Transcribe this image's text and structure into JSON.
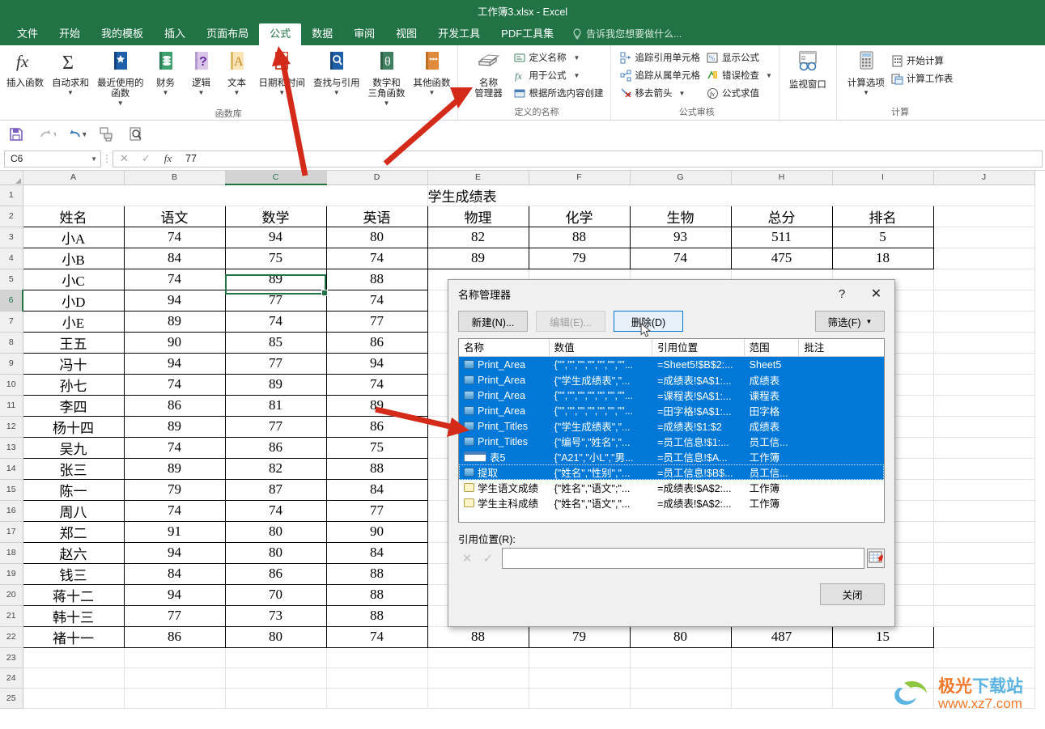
{
  "window": {
    "title": "工作簿3.xlsx - Excel"
  },
  "tabs": [
    {
      "label": "文件",
      "active": false
    },
    {
      "label": "开始",
      "active": false
    },
    {
      "label": "我的模板",
      "active": false
    },
    {
      "label": "插入",
      "active": false
    },
    {
      "label": "页面布局",
      "active": false
    },
    {
      "label": "公式",
      "active": true
    },
    {
      "label": "数据",
      "active": false
    },
    {
      "label": "审阅",
      "active": false
    },
    {
      "label": "视图",
      "active": false
    },
    {
      "label": "开发工具",
      "active": false
    },
    {
      "label": "PDF工具集",
      "active": false
    }
  ],
  "tellme": {
    "placeholder": "告诉我您想要做什么...",
    "icon": "lightbulb-icon"
  },
  "ribbon": {
    "groups": [
      {
        "label": "函数库",
        "buttons": [
          {
            "label": "插入函数",
            "icon": "fx-icon",
            "caret": false
          },
          {
            "label": "自动求和",
            "icon": "autosum-icon",
            "caret": true
          },
          {
            "label": "最近使用的\n函数",
            "icon": "recent-functions-icon",
            "caret": true
          },
          {
            "label": "财务",
            "icon": "financial-icon",
            "caret": true
          },
          {
            "label": "逻辑",
            "icon": "logical-icon",
            "caret": true
          },
          {
            "label": "文本",
            "icon": "text-icon",
            "caret": true
          },
          {
            "label": "日期和时间",
            "icon": "date-time-icon",
            "caret": true
          },
          {
            "label": "查找与引用",
            "icon": "lookup-reference-icon",
            "caret": true
          },
          {
            "label": "数学和\n三角函数",
            "icon": "math-trig-icon",
            "caret": true
          },
          {
            "label": "其他函数",
            "icon": "more-functions-icon",
            "caret": true
          }
        ]
      },
      {
        "label": "定义的名称",
        "big": {
          "label": "名称\n管理器",
          "icon": "name-manager-icon"
        },
        "items": [
          {
            "label": "定义名称",
            "icon": "define-name-icon",
            "caret": true
          },
          {
            "label": "用于公式",
            "icon": "use-in-formula-icon",
            "caret": true
          },
          {
            "label": "根据所选内容创建",
            "icon": "create-from-selection-icon",
            "caret": false
          }
        ]
      },
      {
        "label": "公式审核",
        "col1": [
          {
            "label": "追踪引用单元格",
            "icon": "trace-precedents-icon",
            "caret": false
          },
          {
            "label": "追踪从属单元格",
            "icon": "trace-dependents-icon",
            "caret": false
          },
          {
            "label": "移去箭头",
            "icon": "remove-arrows-icon",
            "caret": true
          }
        ],
        "col2": [
          {
            "label": "显示公式",
            "icon": "show-formulas-icon",
            "caret": false
          },
          {
            "label": "错误检查",
            "icon": "error-checking-icon",
            "caret": true
          },
          {
            "label": "公式求值",
            "icon": "evaluate-formula-icon",
            "caret": false
          }
        ]
      },
      {
        "label": "",
        "watch": {
          "label": "监视窗口",
          "icon": "watch-window-icon"
        }
      },
      {
        "label": "计算",
        "big": {
          "label": "计算选项",
          "icon": "calc-options-icon"
        },
        "items": [
          {
            "label": "开始计算",
            "icon": "calculate-now-icon",
            "caret": false
          },
          {
            "label": "计算工作表",
            "icon": "calculate-sheet-icon",
            "caret": false
          }
        ]
      }
    ]
  },
  "qat": [
    "save-icon",
    "redo-icon",
    "undo-icon",
    "quick-print-icon",
    "print-preview-icon"
  ],
  "formula_bar": {
    "name_box": "C6",
    "cancel_icon": "cancel-icon",
    "enter_icon": "enter-icon",
    "fx_icon": "fx-icon",
    "value": "77"
  },
  "sheet": {
    "columns": [
      "A",
      "B",
      "C",
      "D",
      "E",
      "F",
      "G",
      "H",
      "I",
      "J"
    ],
    "selected_column": "C",
    "selected_row": 6,
    "selected_cell": "C6",
    "title_row": {
      "row": 1,
      "text": "学生成绩表"
    },
    "headers": [
      "姓名",
      "语文",
      "数学",
      "英语",
      "物理",
      "化学",
      "生物",
      "总分",
      "排名"
    ],
    "rows": [
      {
        "n": 3,
        "cells": [
          "小A",
          "74",
          "94",
          "80",
          "82",
          "88",
          "93",
          "511",
          "5"
        ]
      },
      {
        "n": 4,
        "cells": [
          "小B",
          "84",
          "75",
          "74",
          "89",
          "79",
          "74",
          "475",
          "18"
        ]
      },
      {
        "n": 5,
        "cells": [
          "小C",
          "74",
          "89",
          "88",
          "",
          "",
          "",
          "",
          ""
        ]
      },
      {
        "n": 6,
        "cells": [
          "小D",
          "94",
          "77",
          "74",
          "",
          "",
          "",
          "",
          ""
        ]
      },
      {
        "n": 7,
        "cells": [
          "小E",
          "89",
          "74",
          "77",
          "",
          "",
          "",
          "",
          ""
        ]
      },
      {
        "n": 8,
        "cells": [
          "王五",
          "90",
          "85",
          "86",
          "",
          "",
          "",
          "",
          ""
        ]
      },
      {
        "n": 9,
        "cells": [
          "冯十",
          "94",
          "77",
          "94",
          "",
          "",
          "",
          "",
          ""
        ]
      },
      {
        "n": 10,
        "cells": [
          "孙七",
          "74",
          "89",
          "74",
          "",
          "",
          "",
          "",
          ""
        ]
      },
      {
        "n": 11,
        "cells": [
          "李四",
          "86",
          "81",
          "89",
          "",
          "",
          "",
          "",
          ""
        ]
      },
      {
        "n": 12,
        "cells": [
          "杨十四",
          "89",
          "77",
          "86",
          "",
          "",
          "",
          "",
          ""
        ]
      },
      {
        "n": 13,
        "cells": [
          "吴九",
          "74",
          "86",
          "75",
          "",
          "",
          "",
          "",
          ""
        ]
      },
      {
        "n": 14,
        "cells": [
          "张三",
          "89",
          "82",
          "88",
          "",
          "",
          "",
          "",
          ""
        ]
      },
      {
        "n": 15,
        "cells": [
          "陈一",
          "79",
          "87",
          "84",
          "",
          "",
          "",
          "",
          ""
        ]
      },
      {
        "n": 16,
        "cells": [
          "周八",
          "74",
          "74",
          "77",
          "",
          "",
          "",
          "",
          ""
        ]
      },
      {
        "n": 17,
        "cells": [
          "郑二",
          "91",
          "80",
          "90",
          "",
          "",
          "",
          "",
          ""
        ]
      },
      {
        "n": 18,
        "cells": [
          "赵六",
          "94",
          "80",
          "84",
          "",
          "",
          "",
          "",
          ""
        ]
      },
      {
        "n": 19,
        "cells": [
          "钱三",
          "84",
          "86",
          "88",
          "",
          "",
          "",
          "",
          ""
        ]
      },
      {
        "n": 20,
        "cells": [
          "蒋十二",
          "94",
          "70",
          "88",
          "",
          "",
          "",
          "",
          ""
        ]
      },
      {
        "n": 21,
        "cells": [
          "韩十三",
          "77",
          "73",
          "88",
          "",
          "",
          "",
          "",
          ""
        ]
      },
      {
        "n": 22,
        "cells": [
          "褚十一",
          "86",
          "80",
          "74",
          "88",
          "79",
          "80",
          "487",
          "15"
        ]
      }
    ],
    "empty_rows": [
      23,
      24,
      25
    ]
  },
  "dialog": {
    "title": "名称管理器",
    "help_icon": "help-icon",
    "close_icon": "close-icon",
    "buttons": {
      "new": "新建(N)...",
      "edit": "编辑(E)...",
      "delete": "删除(D)",
      "filter": "筛选(F)",
      "close": "关闭"
    },
    "columns": [
      "名称",
      "数值",
      "引用位置",
      "范围",
      "批注"
    ],
    "rows": [
      {
        "icon": "name-range-icon",
        "name": "Print_Area",
        "value": "{\"\",\"\",\"\",\"\",\"\",\"\",\"\"...",
        "refers_to": "=Sheet5!$B$2:...",
        "scope": "Sheet5",
        "comment": "",
        "selected": true
      },
      {
        "icon": "name-range-icon",
        "name": "Print_Area",
        "value": "{\"学生成绩表\",\"...",
        "refers_to": "=成绩表!$A$1:...",
        "scope": "成绩表",
        "comment": "",
        "selected": true
      },
      {
        "icon": "name-range-icon",
        "name": "Print_Area",
        "value": "{\"\",\"\",\"\",\"\",\"\",\"\",\"\"...",
        "refers_to": "=课程表!$A$1:...",
        "scope": "课程表",
        "comment": "",
        "selected": true
      },
      {
        "icon": "name-range-icon",
        "name": "Print_Area",
        "value": "{\"\",\"\",\"\",\"\",\"\",\"\",\"\"...",
        "refers_to": "=田字格!$A$1:...",
        "scope": "田字格",
        "comment": "",
        "selected": true
      },
      {
        "icon": "name-range-icon",
        "name": "Print_Titles",
        "value": "{\"学生成绩表\",\"...",
        "refers_to": "=成绩表!$1:$2",
        "scope": "成绩表",
        "comment": "",
        "selected": true
      },
      {
        "icon": "name-range-icon",
        "name": "Print_Titles",
        "value": "{\"编号\",\"姓名\",\"...",
        "refers_to": "=员工信息!$1:...",
        "scope": "员工信...",
        "comment": "",
        "selected": true
      },
      {
        "icon": "table-icon",
        "name": "表5",
        "value": "{\"A21\",\"小L\",\"男...",
        "refers_to": "=员工信息!$A...",
        "scope": "工作簿",
        "comment": "",
        "selected": true
      },
      {
        "icon": "name-range-icon",
        "name": "提取",
        "value": "{\"姓名\",\"性别\",\"...",
        "refers_to": "=员工信息!$B$...",
        "scope": "员工信...",
        "comment": "",
        "selected": true,
        "cursor": true
      },
      {
        "icon": "named-formula-icon",
        "name": "学生语文成绩",
        "value": "{\"姓名\",\"语文\";\"...",
        "refers_to": "=成绩表!$A$2:...",
        "scope": "工作簿",
        "comment": "",
        "selected": false
      },
      {
        "icon": "named-formula-icon",
        "name": "学生主科成绩",
        "value": "{\"姓名\",\"语文\",\"...",
        "refers_to": "=成绩表!$A$2:...",
        "scope": "工作簿",
        "comment": "",
        "selected": false
      }
    ],
    "refers_to_label": "引用位置(R):",
    "refers_to_value": "",
    "ref_cancel_icon": "cancel-icon",
    "ref_ok_icon": "check-icon",
    "range_picker_icon": "range-picker-icon"
  },
  "watermark": {
    "text_cn": "极光下载站",
    "url": "www.xz7.com"
  },
  "colors": {
    "excel_green": "#217346",
    "selection_blue": "#0078d7",
    "arrow_red": "#d42a1a"
  }
}
